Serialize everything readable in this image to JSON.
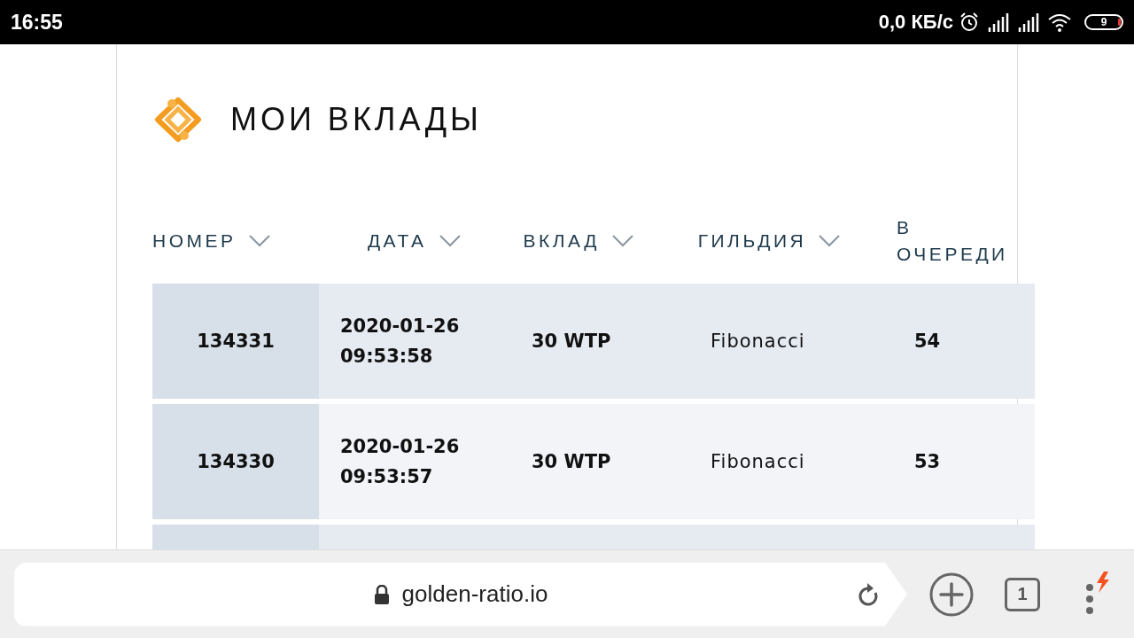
{
  "status_bar": {
    "time": "16:55",
    "speed": "0,0 КБ/с",
    "battery": "9"
  },
  "page": {
    "title": "МОИ ВКЛАДЫ",
    "table": {
      "columns": [
        {
          "label": "НОМЕР",
          "sortable": true
        },
        {
          "label": "ДАТА",
          "sortable": true
        },
        {
          "label": "ВКЛАД",
          "sortable": true
        },
        {
          "label": "ГИЛЬДИЯ",
          "sortable": true
        },
        {
          "label": "В ОЧЕРЕДИ",
          "sortable": false
        }
      ],
      "rows": [
        {
          "number": "134331",
          "date": "2020-01-26 09:53:58",
          "amount": "30 WTP",
          "guild": "Fibonacci",
          "queue": "54"
        },
        {
          "number": "134330",
          "date": "2020-01-26 09:53:57",
          "amount": "30 WTP",
          "guild": "Fibonacci",
          "queue": "53"
        }
      ]
    }
  },
  "browser_bar": {
    "url": "golden-ratio.io",
    "tab_count": "1"
  }
}
